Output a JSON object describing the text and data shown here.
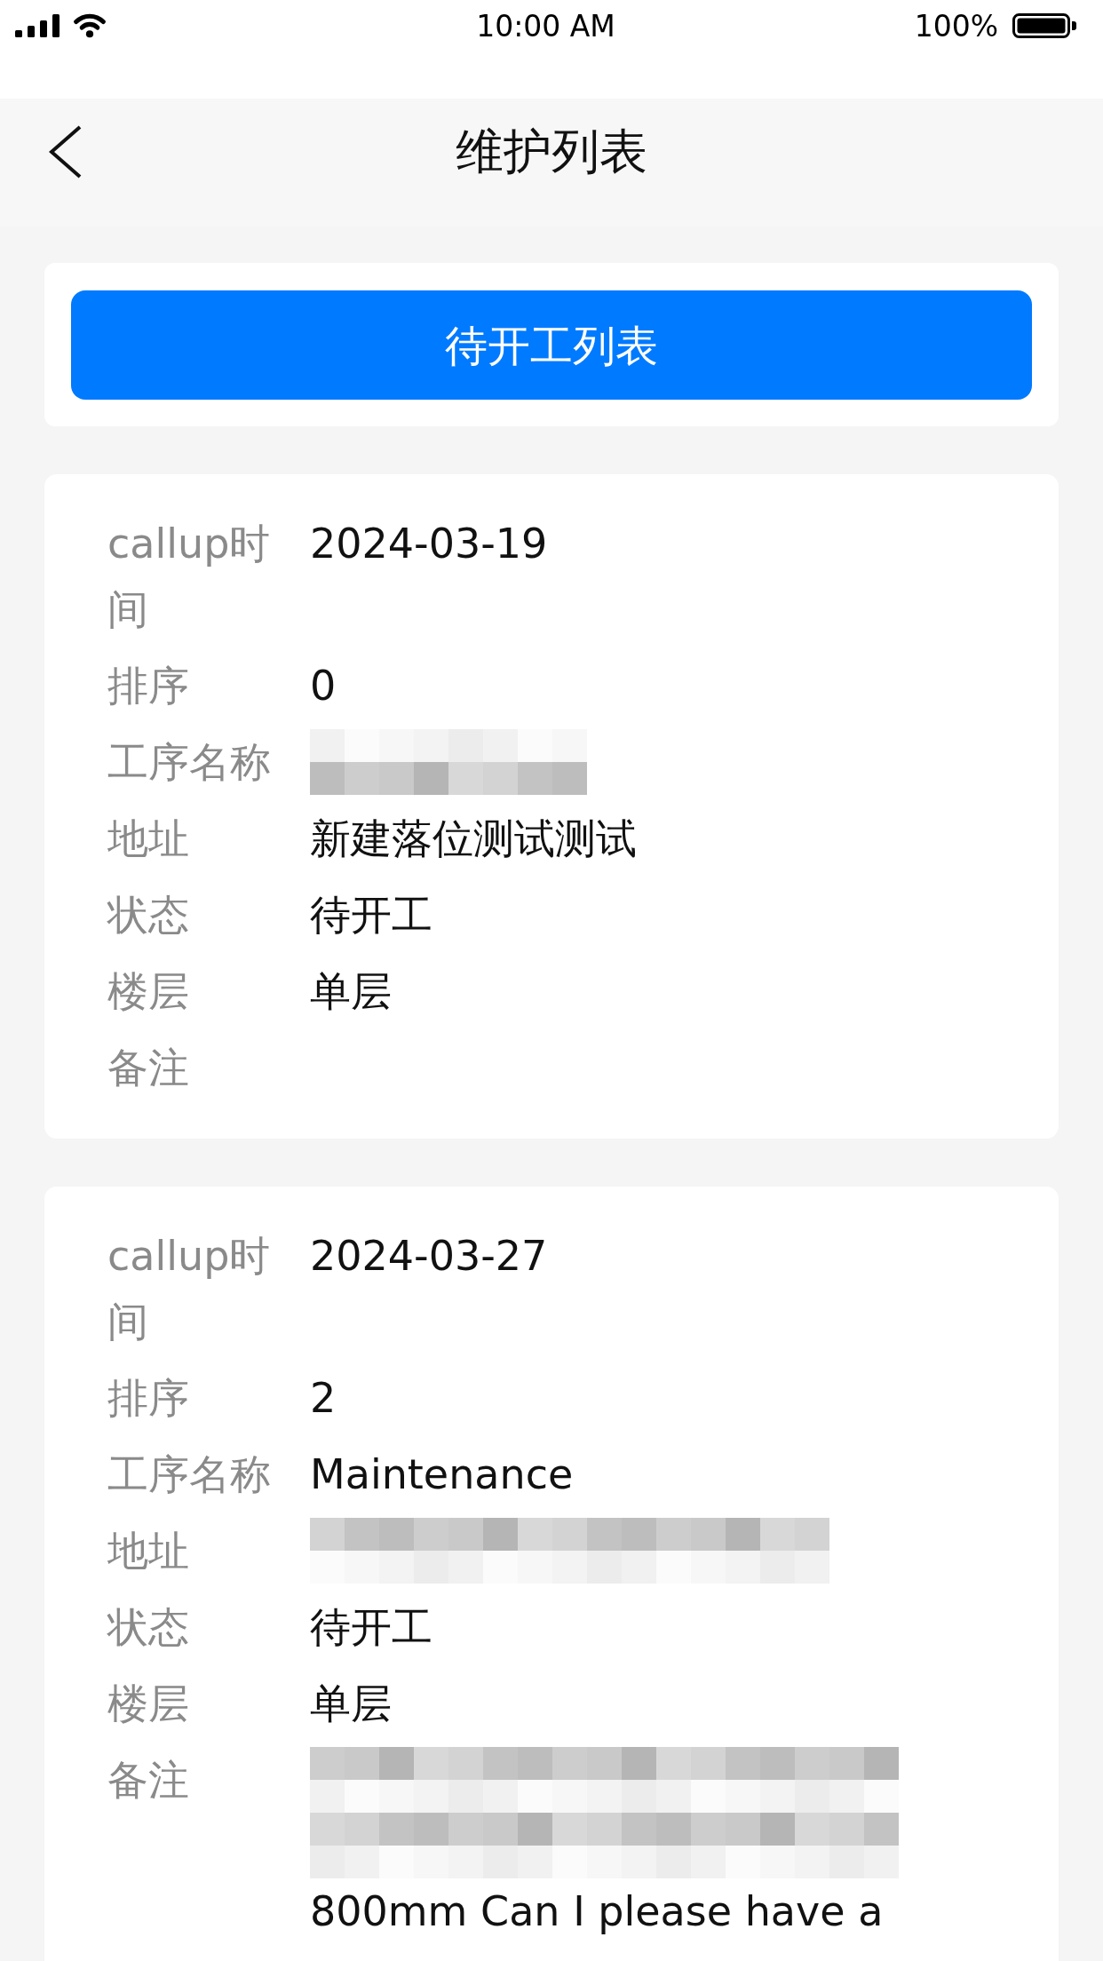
{
  "status_bar": {
    "time": "10:00 AM",
    "battery": "100%"
  },
  "header": {
    "title": "维护列表"
  },
  "filter_button": {
    "label": "待开工列表"
  },
  "records": [
    {
      "fields": [
        {
          "label": "callup时间",
          "value": [
            {
              "kind": "text",
              "text": "2024-03-19"
            }
          ]
        },
        {
          "label": "排序",
          "value": [
            {
              "kind": "text",
              "text": "0"
            }
          ]
        },
        {
          "label": "工序名称",
          "value": [
            {
              "kind": "redacted"
            }
          ]
        },
        {
          "label": "地址",
          "value": [
            {
              "kind": "text",
              "text": "新建落位测试测试"
            }
          ]
        },
        {
          "label": "状态",
          "value": [
            {
              "kind": "text",
              "text": "待开工"
            }
          ]
        },
        {
          "label": "楼层",
          "value": [
            {
              "kind": "text",
              "text": "单层"
            }
          ]
        },
        {
          "label": "备注"
        }
      ]
    },
    {
      "fields": [
        {
          "label": "callup时间",
          "value": [
            {
              "kind": "text",
              "text": "2024-03-27"
            }
          ]
        },
        {
          "label": "排序",
          "value": [
            {
              "kind": "text",
              "text": "2"
            }
          ]
        },
        {
          "label": "工序名称",
          "value": [
            {
              "kind": "text",
              "text": "Maintenance"
            }
          ]
        },
        {
          "label": "地址",
          "value": [
            {
              "kind": "redacted"
            }
          ]
        },
        {
          "label": "状态",
          "value": [
            {
              "kind": "text",
              "text": "待开工"
            }
          ]
        },
        {
          "label": "楼层",
          "value": [
            {
              "kind": "text",
              "text": "单层"
            }
          ]
        },
        {
          "label": "备注",
          "value": [
            {
              "kind": "redacted"
            },
            {
              "kind": "redacted"
            },
            {
              "kind": "text",
              "text": "800mm Can I please have a"
            }
          ]
        }
      ]
    }
  ]
}
